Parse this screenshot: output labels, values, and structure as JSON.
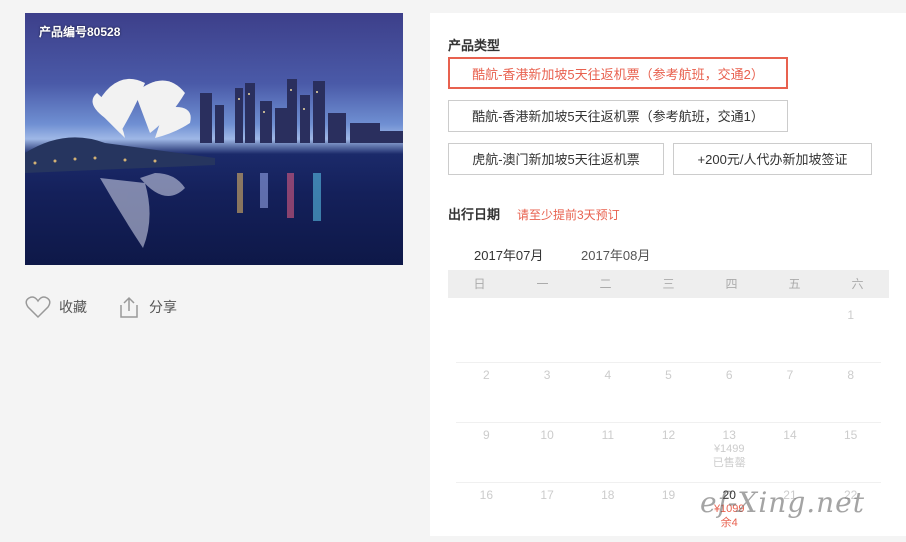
{
  "product": {
    "code_label": "产品编号80528"
  },
  "actions": {
    "favorite": "收藏",
    "share": "分享"
  },
  "product_type": {
    "title": "产品类型",
    "options": [
      "酷航-香港新加坡5天往返机票（参考航班，交通2）",
      "酷航-香港新加坡5天往返机票（参考航班，交通1）",
      "虎航-澳门新加坡5天往返机票",
      "+200元/人代办新加坡签证"
    ],
    "selected_index": 0
  },
  "travel_date": {
    "title": "出行日期",
    "hint": "请至少提前3天预订"
  },
  "months": [
    "2017年07月",
    "2017年08月"
  ],
  "weekdays": [
    "日",
    "一",
    "二",
    "三",
    "四",
    "五",
    "六"
  ],
  "calendar_rows": [
    [
      {
        "d": ""
      },
      {
        "d": ""
      },
      {
        "d": ""
      },
      {
        "d": ""
      },
      {
        "d": ""
      },
      {
        "d": ""
      },
      {
        "d": "1"
      }
    ],
    [
      {
        "d": "2"
      },
      {
        "d": "3"
      },
      {
        "d": "4"
      },
      {
        "d": "5"
      },
      {
        "d": "6"
      },
      {
        "d": "7"
      },
      {
        "d": "8"
      }
    ],
    [
      {
        "d": "9"
      },
      {
        "d": "10"
      },
      {
        "d": "11"
      },
      {
        "d": "12"
      },
      {
        "d": "13",
        "p": "¥1499",
        "s": "已售罄"
      },
      {
        "d": "14"
      },
      {
        "d": "15"
      }
    ],
    [
      {
        "d": "16"
      },
      {
        "d": "17"
      },
      {
        "d": "18"
      },
      {
        "d": "19"
      },
      {
        "d": "20",
        "p": "¥1099",
        "s": "余4",
        "on": true
      },
      {
        "d": "21"
      },
      {
        "d": "22"
      }
    ]
  ],
  "watermark": "ef-Xing.net",
  "colors": {
    "accent": "#e8614f"
  }
}
